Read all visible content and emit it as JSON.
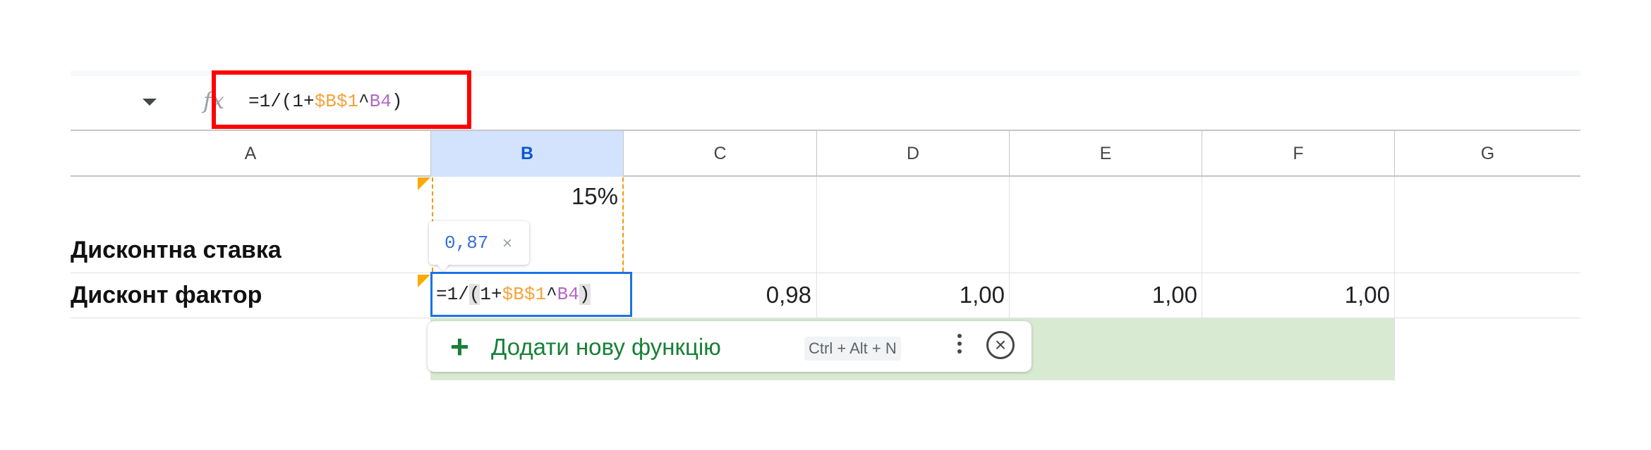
{
  "formula_bar": {
    "fx_label": "fx",
    "formula_parts": [
      {
        "text": "=1/(1+",
        "role": "plain"
      },
      {
        "text": "$B$1",
        "role": "ref1"
      },
      {
        "text": "^",
        "role": "plain"
      },
      {
        "text": "B4",
        "role": "ref2"
      },
      {
        "text": ")",
        "role": "plain"
      }
    ]
  },
  "columns": [
    "A",
    "B",
    "C",
    "D",
    "E",
    "F",
    "G"
  ],
  "rows": {
    "discount_rate": {
      "label": "Дисконтна ставка",
      "B": "15%"
    },
    "discount_factor": {
      "label": "Дисконт фактор",
      "C": "0,98",
      "D": "1,00",
      "E": "1,00",
      "F": "1,00"
    }
  },
  "active_cell": {
    "formula_parts": [
      {
        "text": "=1/",
        "role": "plain"
      },
      {
        "text": "(",
        "role": "paren"
      },
      {
        "text": "1+",
        "role": "plain"
      },
      {
        "text": "$B$1",
        "role": "ref1"
      },
      {
        "text": "^",
        "role": "plain"
      },
      {
        "text": "B4",
        "role": "ref2"
      },
      {
        "text": ")",
        "role": "paren"
      }
    ]
  },
  "tooltip": {
    "value": "0,87",
    "close": "×"
  },
  "suggestion": {
    "plus": "+",
    "label": "Додати нову функцію",
    "shortcut": "Ctrl + Alt + N",
    "dismiss": "⊗"
  },
  "colors": {
    "ref1": "#f6a33b",
    "ref2": "#b568c7",
    "accent": "#1a73e8",
    "green_fill": "#d9ead3",
    "highlight": "#ff0000"
  }
}
